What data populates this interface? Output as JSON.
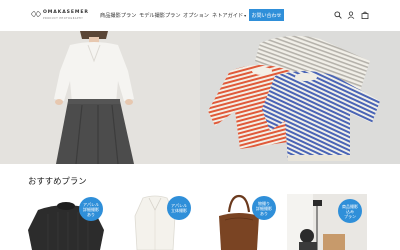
{
  "brand": {
    "name": "OMAKASEMER",
    "tagline": "PRODUCT PHOTOGRAPHY"
  },
  "nav": {
    "items": [
      {
        "label": "商品撮影プラン"
      },
      {
        "label": "モデル撮影プラン"
      },
      {
        "label": "オプション"
      },
      {
        "label": "ネトアガイド",
        "has_dropdown": true
      }
    ],
    "cta_label": "お問い合わせ"
  },
  "header_icons": [
    "search-icon",
    "user-icon",
    "shopping-bag-icon"
  ],
  "hero": {
    "left_image": "model-white-blouse-gray-skirt",
    "right_image": "striped-knit-sweaters"
  },
  "recommended": {
    "title": "おすすめプラン",
    "cards": [
      {
        "image": "black-knit-sweater",
        "badge_lines": [
          "アパレル",
          "詳細撮影",
          "あり"
        ]
      },
      {
        "image": "white-blouse",
        "badge_lines": [
          "アパレル",
          "立体撮影"
        ]
      },
      {
        "image": "brown-leather-bag",
        "badge_lines": [
          "物撮り",
          "詳細撮影",
          "あり"
        ]
      },
      {
        "image": "photo-studio-setup",
        "badge_lines": [
          "商品撮影",
          "込み",
          "プラン"
        ]
      }
    ]
  },
  "colors": {
    "accent": "#2f8fd9",
    "text": "#222222",
    "background": "#ffffff"
  }
}
